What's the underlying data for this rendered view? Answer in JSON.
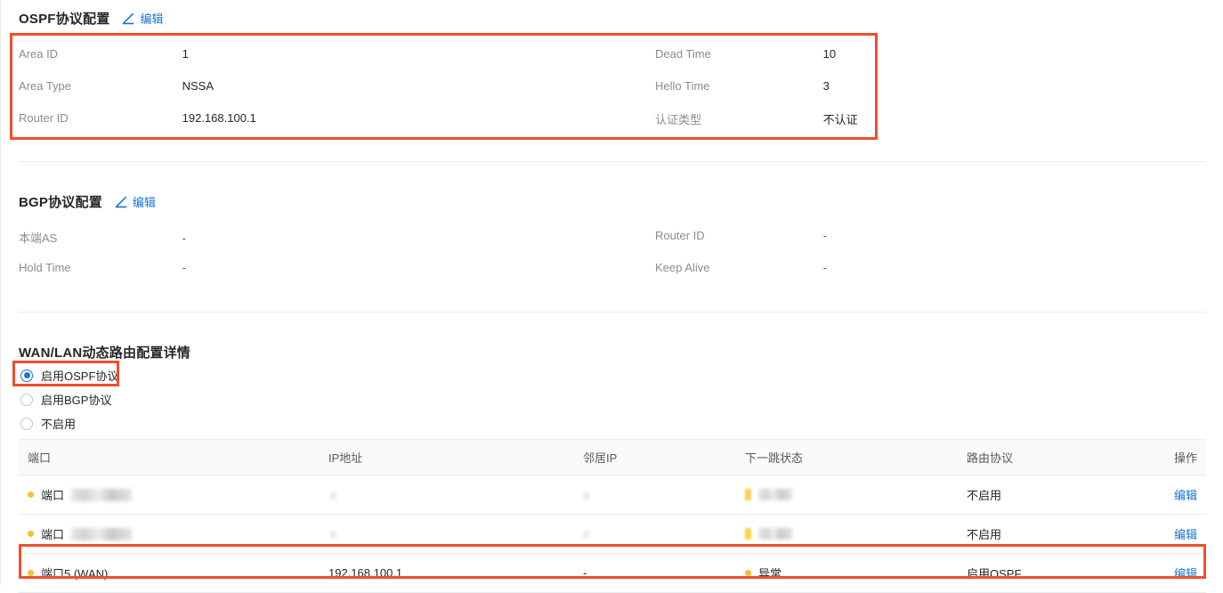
{
  "ospf": {
    "title": "OSPF协议配置",
    "edit_label": "编辑",
    "edit_icon": "pencil-icon",
    "fields_left": [
      {
        "label": "Area ID",
        "value": "1"
      },
      {
        "label": "Area Type",
        "value": "NSSA"
      },
      {
        "label": "Router ID",
        "value": "192.168.100.1"
      }
    ],
    "fields_right": [
      {
        "label": "Dead Time",
        "value": "10"
      },
      {
        "label": "Hello Time",
        "value": "3"
      },
      {
        "label": "认证类型",
        "value": "不认证"
      }
    ]
  },
  "bgp": {
    "title": "BGP协议配置",
    "edit_label": "编辑",
    "edit_icon": "pencil-icon",
    "fields_left": [
      {
        "label": "本端AS",
        "value": "-"
      },
      {
        "label": "Hold Time",
        "value": "-"
      }
    ],
    "fields_right": [
      {
        "label": "Router ID",
        "value": "-"
      },
      {
        "label": "Keep Alive",
        "value": "-"
      }
    ]
  },
  "dynamic_routing": {
    "title": "WAN/LAN动态路由配置详情",
    "radios": [
      {
        "label": "启用OSPF协议",
        "checked": true
      },
      {
        "label": "启用BGP协议",
        "checked": false
      },
      {
        "label": "不启用",
        "checked": false
      }
    ],
    "table": {
      "columns": [
        "端口",
        "IP地址",
        "邻居IP",
        "下一跳状态",
        "路由协议",
        "操作"
      ],
      "rows": [
        {
          "port": "端口",
          "port_redacted": true,
          "ip": "",
          "ip_redacted": true,
          "neighbor_ip": "",
          "neighbor_redacted": true,
          "next_hop": "",
          "next_hop_redacted": true,
          "protocol": "不启用",
          "action": "编辑",
          "status_color": "#fbc02d"
        },
        {
          "port": "端口",
          "port_redacted": true,
          "ip": "",
          "ip_redacted": true,
          "neighbor_ip": "",
          "neighbor_redacted": true,
          "next_hop": "",
          "next_hop_redacted": true,
          "protocol": "不启用",
          "action": "编辑",
          "status_color": "#fbc02d"
        },
        {
          "port": "端口5 (WAN)",
          "port_redacted": false,
          "ip": "192.168.100.1",
          "ip_redacted": false,
          "neighbor_ip": "-",
          "neighbor_redacted": false,
          "next_hop": "异常",
          "next_hop_redacted": false,
          "protocol": "启用OSPF",
          "action": "编辑",
          "status_color": "#fbc02d"
        }
      ]
    }
  },
  "colors": {
    "highlight_border": "#ef4f2c",
    "link": "#1874d2",
    "radio_checked": "#1a73e8",
    "status_dot": "#fbc02d"
  }
}
